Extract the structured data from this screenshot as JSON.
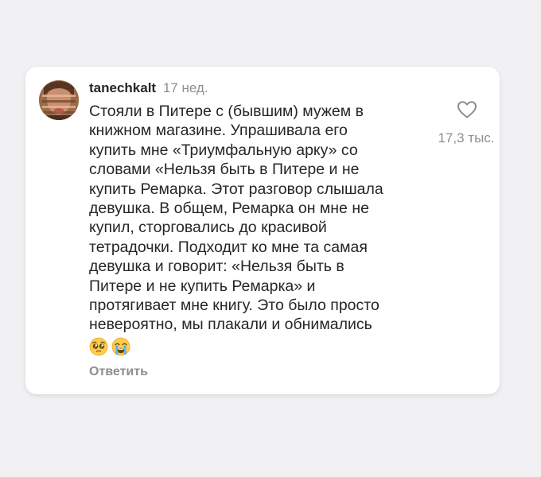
{
  "comment": {
    "username": "tanechkalt",
    "timestamp": "17 нед.",
    "text": "Стояли в Питере с (бывшим) мужем в\nкнижном магазине. Упрашивала его\nкупить мне «Триумфальную арку» со\nсловами «Нельзя быть в Питере и не\nкупить Ремарка. Этот разговор слышала\nдевушка. В общем, Ремарка он мне не\nкупил, сторговались до красивой\nтетрадочки. Подходит ко мне та самая\nдевушка и говорит: «Нельзя быть в\nПитере и не купить Ремарка» и\nпротягивает мне книгу. Это было просто\nневероятно, мы плакали и обнимались",
    "emojis": [
      "pleading-face",
      "loudly-crying-face"
    ],
    "reply_label": "Ответить",
    "like_icon": "heart-outline-icon",
    "like_count": "17,3 тыс."
  },
  "colors": {
    "background": "#f1f1f3",
    "card": "#ffffff",
    "text_primary": "#262626",
    "text_secondary": "#8e8e8e"
  }
}
